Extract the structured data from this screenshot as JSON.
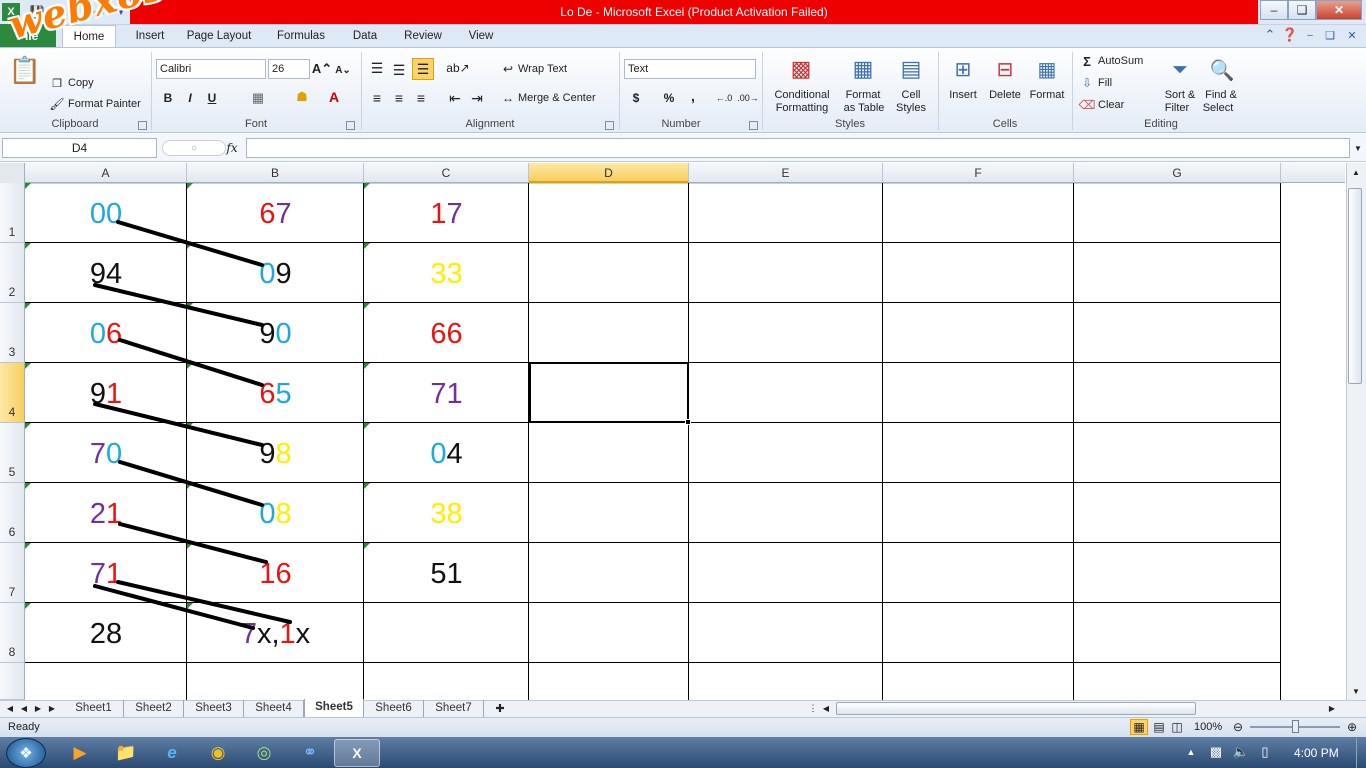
{
  "window": {
    "title": "Lo De  -  Microsoft Excel (Product Activation Failed)"
  },
  "colors": {
    "blue": "#1ea8e0",
    "red": "#ee1111",
    "purple": "#7030a0",
    "black": "#111111",
    "yellow": "#ffee00"
  },
  "ribbon": {
    "tabs": [
      "File",
      "Home",
      "Insert",
      "Page Layout",
      "Formulas",
      "Data",
      "Review",
      "View"
    ],
    "clipboard": {
      "copy": "Copy",
      "format_painter": "Format Painter",
      "label": "Clipboard"
    },
    "font": {
      "name": "Calibri",
      "size": "26",
      "label": "Font",
      "bold": "B",
      "italic": "I",
      "underline": "U"
    },
    "alignment": {
      "wrap": "Wrap Text",
      "merge": "Merge & Center",
      "label": "Alignment"
    },
    "number": {
      "format": "Text",
      "label": "Number",
      "currency": "$",
      "percent": "%",
      "comma": ","
    },
    "styles": {
      "conditional_1": "Conditional",
      "conditional_2": "Formatting",
      "table_1": "Format",
      "table_2": "as Table",
      "cell_1": "Cell",
      "cell_2": "Styles",
      "label": "Styles"
    },
    "cells": {
      "insert": "Insert",
      "delete": "Delete",
      "format": "Format",
      "label": "Cells"
    },
    "editing": {
      "autosum": "AutoSum",
      "fill": "Fill",
      "clear": "Clear",
      "sort_1": "Sort &",
      "sort_2": "Filter",
      "find_1": "Find &",
      "find_2": "Select",
      "label": "Editing"
    }
  },
  "formula_bar": {
    "name_box": "D4",
    "fx": "fx",
    "value": ""
  },
  "columns": [
    "A",
    "B",
    "C",
    "D",
    "E",
    "F",
    "G"
  ],
  "selected_column": "D",
  "selected_row": "4",
  "rows": [
    "1",
    "2",
    "3",
    "4",
    "5",
    "6",
    "7",
    "8"
  ],
  "cells": {
    "A": [
      [
        [
          "0",
          "blue"
        ],
        [
          "0",
          "blue"
        ]
      ],
      [
        [
          "9",
          "black"
        ],
        [
          "4",
          "black"
        ]
      ],
      [
        [
          "0",
          "blue"
        ],
        [
          "6",
          "red"
        ]
      ],
      [
        [
          "9",
          "black"
        ],
        [
          "1",
          "red"
        ]
      ],
      [
        [
          "7",
          "purple"
        ],
        [
          "0",
          "blue"
        ]
      ],
      [
        [
          "2",
          "purple"
        ],
        [
          "1",
          "red"
        ]
      ],
      [
        [
          "7",
          "purple"
        ],
        [
          "1",
          "red"
        ]
      ],
      [
        [
          "2",
          "black"
        ],
        [
          "8",
          "black"
        ]
      ]
    ],
    "B": [
      [
        [
          "6",
          "red"
        ],
        [
          "7",
          "purple"
        ]
      ],
      [
        [
          "0",
          "blue"
        ],
        [
          "9",
          "black"
        ]
      ],
      [
        [
          "9",
          "black"
        ],
        [
          "0",
          "blue"
        ]
      ],
      [
        [
          "6",
          "red"
        ],
        [
          "5",
          "blue"
        ]
      ],
      [
        [
          "9",
          "black"
        ],
        [
          "8",
          "yellow"
        ]
      ],
      [
        [
          "0",
          "blue"
        ],
        [
          "8",
          "yellow"
        ]
      ],
      [
        [
          "1",
          "red"
        ],
        [
          "6",
          "red"
        ]
      ],
      [
        [
          "7",
          "purple"
        ],
        [
          "x,",
          "black"
        ],
        [
          "1",
          "red"
        ],
        [
          "x",
          "black"
        ]
      ]
    ],
    "C": [
      [
        [
          "1",
          "red"
        ],
        [
          "7",
          "purple"
        ]
      ],
      [
        [
          "3",
          "yellow"
        ],
        [
          "3",
          "yellow"
        ]
      ],
      [
        [
          "6",
          "red"
        ],
        [
          "6",
          "red"
        ]
      ],
      [
        [
          "7",
          "purple"
        ],
        [
          "1",
          "purple"
        ]
      ],
      [
        [
          "0",
          "blue"
        ],
        [
          "4",
          "black"
        ]
      ],
      [
        [
          "3",
          "yellow"
        ],
        [
          "8",
          "yellow"
        ]
      ],
      [
        [
          "5",
          "black"
        ],
        [
          "1",
          "black"
        ]
      ],
      []
    ]
  },
  "sheets": [
    "Sheet1",
    "Sheet2",
    "Sheet3",
    "Sheet4",
    "Sheet5",
    "Sheet6",
    "Sheet7"
  ],
  "active_sheet": "Sheet5",
  "status": {
    "ready": "Ready",
    "zoom": "100%"
  },
  "taskbar": {
    "time": "4:00 PM"
  },
  "watermark": "webxoso.net"
}
